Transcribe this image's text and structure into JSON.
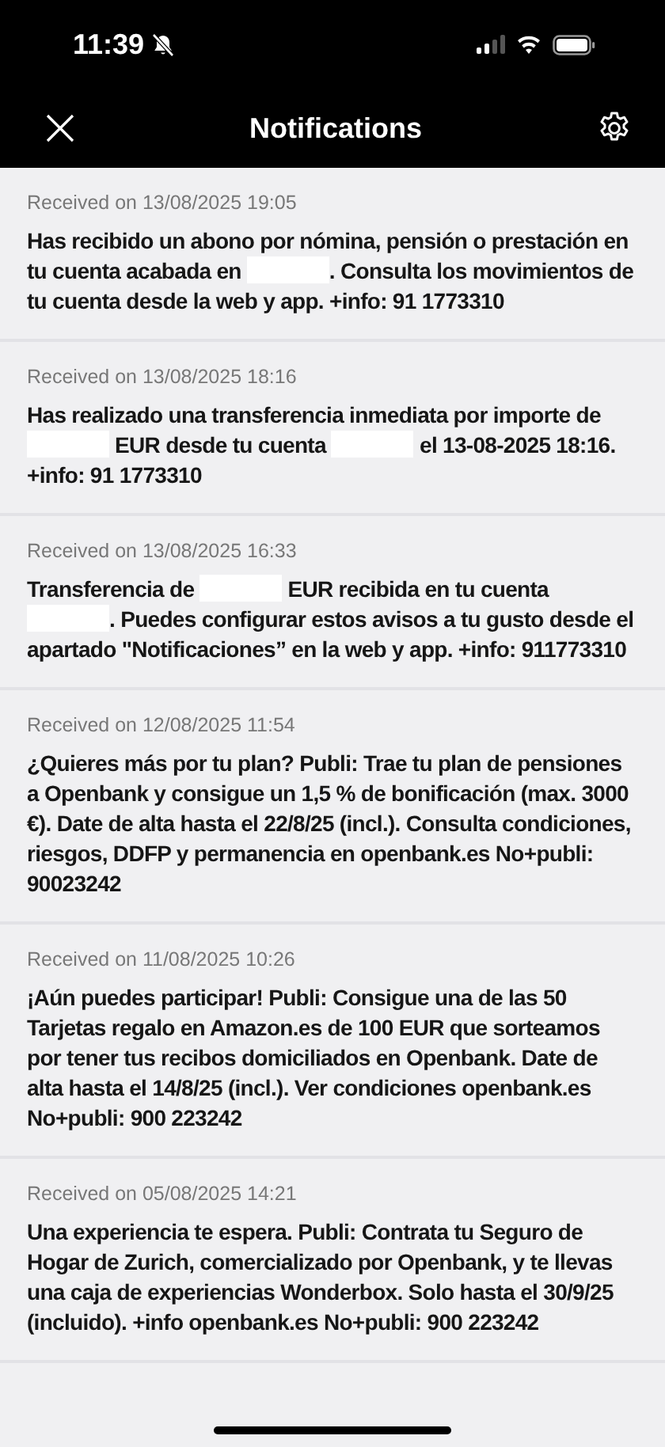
{
  "status_bar": {
    "time": "11:39",
    "silenced": true
  },
  "header": {
    "title": "Notifications"
  },
  "notifications": [
    {
      "received": "Received on 13/08/2025 19:05",
      "parts": [
        {
          "kind": "text",
          "text": "Has recibido un abono por nómina, pensión o prestación en tu cuenta acabada en "
        },
        {
          "kind": "redacted"
        },
        {
          "kind": "text",
          "text": ". Consulta los movimientos de tu cuenta desde la web y app. +info: 91 1773310"
        }
      ]
    },
    {
      "received": "Received on 13/08/2025 18:16",
      "parts": [
        {
          "kind": "text",
          "text": "Has realizado una transferencia inmediata por importe de "
        },
        {
          "kind": "redacted"
        },
        {
          "kind": "text",
          "text": " EUR desde tu cuenta "
        },
        {
          "kind": "redacted"
        },
        {
          "kind": "text",
          "text": " el 13-08-2025 18:16. +info: 91 1773310"
        }
      ]
    },
    {
      "received": "Received on 13/08/2025 16:33",
      "parts": [
        {
          "kind": "text",
          "text": "Transferencia de "
        },
        {
          "kind": "redacted"
        },
        {
          "kind": "text",
          "text": " EUR recibida en tu cuenta "
        },
        {
          "kind": "redacted"
        },
        {
          "kind": "text",
          "text": ". Puedes configurar estos avisos a tu gusto desde el apartado \"Notificaciones” en la web y app. +info: 911773310"
        }
      ]
    },
    {
      "received": "Received on 12/08/2025 11:54",
      "parts": [
        {
          "kind": "text",
          "text": "¿Quieres más por tu plan? Publi: Trae tu plan de pensiones a Openbank y consigue un 1,5 % de bonificación (max. 3000 €). Date de alta hasta el 22/8/25 (incl.). Consulta condiciones, riesgos, DDFP y permanencia en openbank.es No+publi: 90023242"
        }
      ]
    },
    {
      "received": "Received on 11/08/2025 10:26",
      "parts": [
        {
          "kind": "text",
          "text": "¡Aún puedes participar! Publi: Consigue una de las 50 Tarjetas regalo en Amazon.es de 100 EUR que sorteamos por tener tus recibos domiciliados en Openbank. Date de alta  hasta el 14/8/25 (incl.). Ver condiciones openbank.es No+publi: 900 223242"
        }
      ]
    },
    {
      "received": "Received on 05/08/2025 14:21",
      "parts": [
        {
          "kind": "text",
          "text": "Una experiencia te espera. Publi: Contrata tu Seguro de Hogar de Zurich, comercializado por Openbank, y te llevas una caja de experiencias Wonderbox. Solo hasta el 30/9/25 (incluido). +info openbank.es No+publi: 900 223242"
        }
      ]
    }
  ]
}
